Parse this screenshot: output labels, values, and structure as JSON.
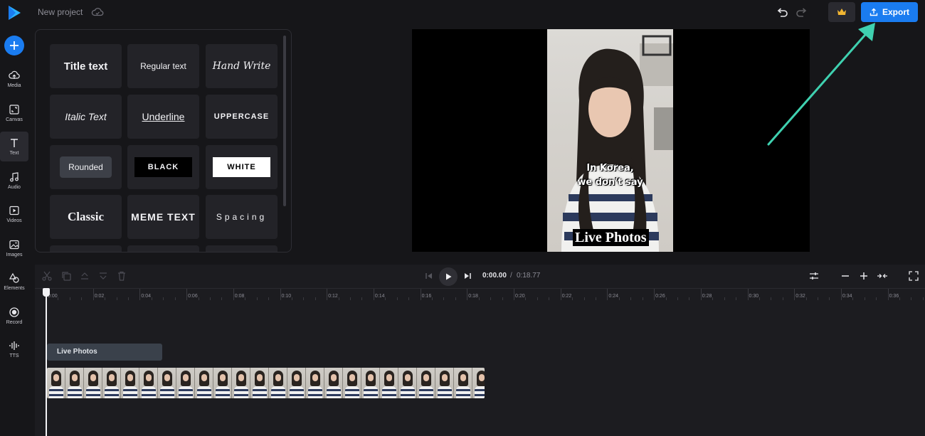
{
  "header": {
    "project_title": "New project",
    "export_label": "Export"
  },
  "sidebar": {
    "items": [
      {
        "label": "Media"
      },
      {
        "label": "Canvas"
      },
      {
        "label": "Text"
      },
      {
        "label": "Audio"
      },
      {
        "label": "Videos"
      },
      {
        "label": "Images"
      },
      {
        "label": "Elements"
      },
      {
        "label": "Record"
      },
      {
        "label": "TTS"
      }
    ]
  },
  "text_panel": {
    "styles": [
      "Title text",
      "Regular text",
      "Hand Write",
      "Italic Text",
      "Underline",
      "UPPERCASE",
      "Rounded",
      "BLACK",
      "WHITE",
      "Classic",
      "MEME TEXT",
      "Spacing"
    ]
  },
  "preview": {
    "caption_line1": "In Korea,",
    "caption_line2": "we don't say",
    "caption_title": "Live Photos"
  },
  "timeline": {
    "current_time": "0:00.00",
    "separator": "/",
    "total_time": "0:18.77",
    "ruler_labels": [
      "0:00",
      "0:02",
      "0:04",
      "0:06",
      "0:08",
      "0:10",
      "0:12",
      "0:14",
      "0:16",
      "0:18",
      "0:20",
      "0:22",
      "0:24",
      "0:26",
      "0:28",
      "0:30",
      "0:32",
      "0:34",
      "0:36"
    ],
    "text_clip_label": "Live Photos"
  },
  "colors": {
    "accent": "#1a7cf0",
    "arrow": "#3fd1b0",
    "background": "#161619"
  }
}
